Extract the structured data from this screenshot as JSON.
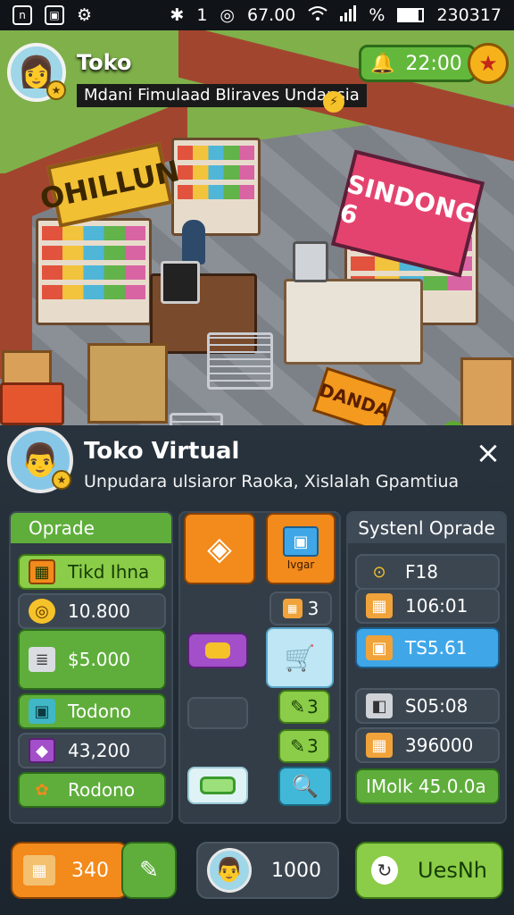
{
  "status_bar": {
    "left_icons": [
      "n",
      "▣",
      "⚙"
    ],
    "center_icons": [
      "✱",
      "1",
      "◎"
    ],
    "time": "67.00",
    "battery_text": "%",
    "date": "230317"
  },
  "scene": {
    "sign_left": "OHILLUN",
    "sign_right": "SINDONG 6",
    "sign_floor": "DANDA"
  },
  "hud": {
    "player_name": "Toko",
    "subtitle": "Mdani Fimulaad Bliraves Undansia",
    "timer": "22:00"
  },
  "panel": {
    "title": "Toko Virtual",
    "subtitle": "Unpudara ulsiaror Raoka, Xislalah Gpamtiua",
    "close_icon": "×",
    "upgrade_column": {
      "header": "Oprade",
      "items": [
        {
          "icon": "crate-icon",
          "label": "Tikd Ihna"
        },
        {
          "icon": "coin-icon",
          "label": "10.800"
        },
        {
          "icon": "stack-icon",
          "label": "$5.000"
        },
        {
          "icon": "box-icon",
          "label": "Todono"
        },
        {
          "icon": "gift-icon",
          "label": "43,200"
        },
        {
          "icon": "flower-icon",
          "label": "Rodono"
        }
      ]
    },
    "middle": {
      "tile_top_right_label": "Ivgar",
      "small_count": "3",
      "badge_1": "3",
      "badge_2": "3"
    },
    "system_column": {
      "header": "Systenl Oprade",
      "items": [
        {
          "icon": "pin-icon",
          "label": "F18"
        },
        {
          "icon": "crate-icon",
          "label": "106:01"
        },
        {
          "icon": "parcel-icon",
          "label": "TS5.61"
        },
        {
          "icon": "cube-icon",
          "label": "S05:08"
        },
        {
          "icon": "crate-icon",
          "label": "396000"
        },
        {
          "icon": "",
          "label": "IMolk 45.0.0a"
        }
      ]
    }
  },
  "bottom_bar": {
    "crate_count": "340",
    "profile_value": "1000",
    "action_label": "UesNh"
  },
  "colors": {
    "accent_green": "#5fae3c",
    "accent_orange": "#f28a1c",
    "accent_blue": "#3fa7e8"
  }
}
